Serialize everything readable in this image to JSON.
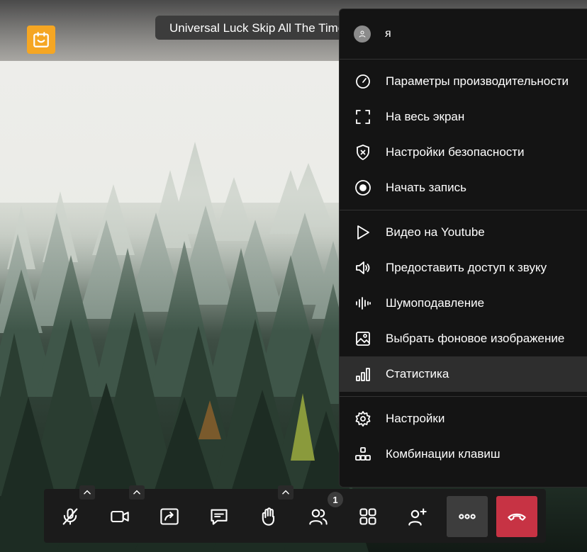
{
  "meeting": {
    "title": "Universal Luck Skip All The Time"
  },
  "menu": {
    "user_name": "я",
    "groups": [
      [
        {
          "label": "Параметры производительности",
          "icon": "gauge-icon"
        },
        {
          "label": "На весь экран",
          "icon": "fullscreen-icon"
        },
        {
          "label": "Настройки безопасности",
          "icon": "shield-icon"
        },
        {
          "label": "Начать запись",
          "icon": "record-icon"
        }
      ],
      [
        {
          "label": "Видео на Youtube",
          "icon": "play-icon"
        },
        {
          "label": "Предоставить доступ к звуку",
          "icon": "speaker-icon"
        },
        {
          "label": "Шумоподавление",
          "icon": "waveform-icon"
        },
        {
          "label": "Выбрать фоновое изображение",
          "icon": "image-icon"
        },
        {
          "label": "Статистика",
          "icon": "bar-chart-icon",
          "active": true
        }
      ],
      [
        {
          "label": "Настройки",
          "icon": "gear-icon"
        },
        {
          "label": "Комбинации клавиш",
          "icon": "shortcuts-icon"
        }
      ]
    ]
  },
  "toolbar": {
    "participants_count": "1",
    "buttons": [
      "mic-muted-icon",
      "camera-icon",
      "share-screen-icon",
      "chat-icon",
      "raise-hand-icon",
      "participants-icon",
      "tile-view-icon",
      "invite-icon",
      "more-icon",
      "hangup-icon"
    ]
  },
  "colors": {
    "accent_logo": "#f5a623",
    "hangup": "#c73344",
    "menu_bg": "#141414",
    "active_item_bg": "#2e2e2e"
  }
}
